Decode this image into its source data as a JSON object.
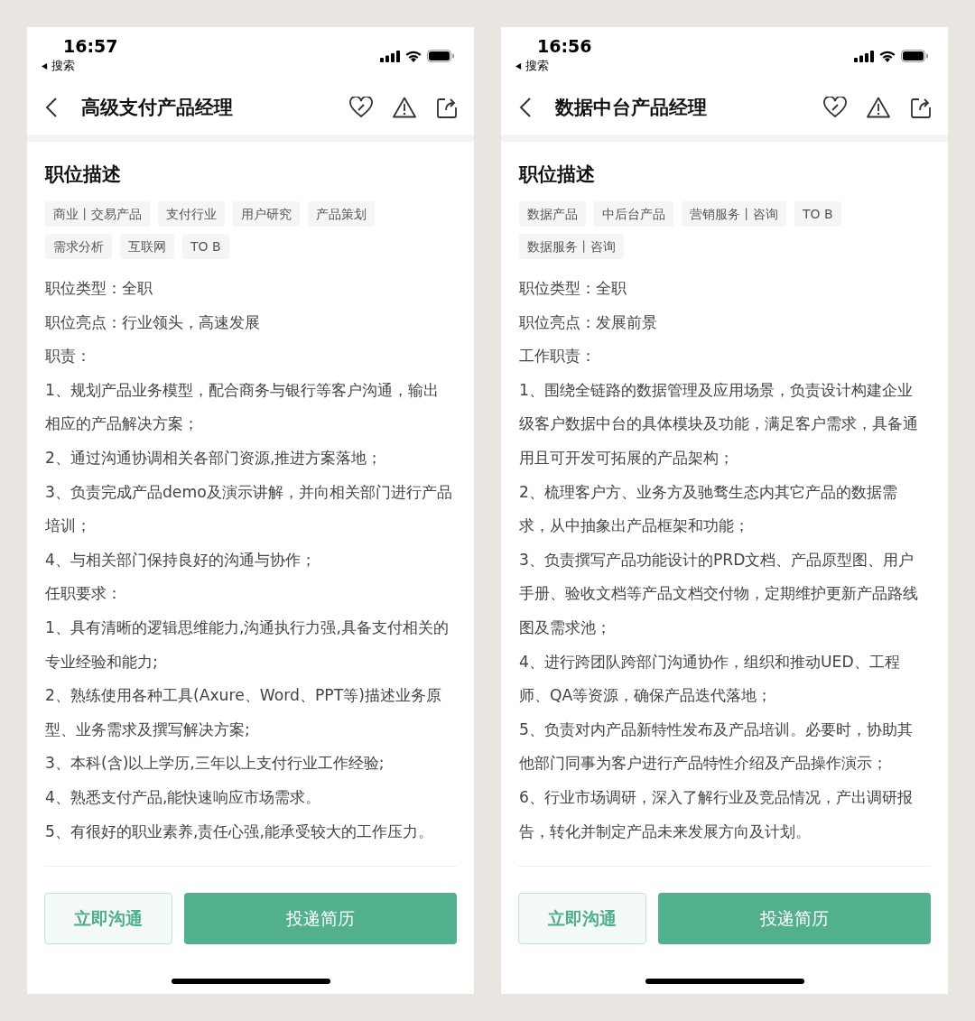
{
  "screens": [
    {
      "status_bar": {
        "time": "16:57",
        "back_app": "搜索"
      },
      "title": "高级支付产品经理",
      "section_title": "职位描述",
      "tags": [
        "商业丨交易产品",
        "支付行业",
        "用户研究",
        "产品策划",
        "需求分析",
        "互联网",
        "TO B"
      ],
      "lines": [
        "职位类型：全职",
        "职位亮点：行业领头，高速发展",
        "职责：",
        "1、规划产品业务模型，配合商务与银行等客户沟通，输出相应的产品解决方案；",
        "2、通过沟通协调相关各部门资源,推进方案落地；",
        "3、负责完成产品demo及演示讲解，并向相关部门进行产品培训；",
        "4、与相关部门保持良好的沟通与协作；",
        "任职要求：",
        "1、具有清晰的逻辑思维能力,沟通执行力强,具备支付相关的专业经验和能力;",
        "2、熟练使用各种工具(Axure、Word、PPT等)描述业务原型、业务需求及撰写解决方案;",
        "3、本科(含)以上学历,三年以上支付行业工作经验;",
        "4、熟悉支付产品,能快速响应市场需求。",
        "5、有很好的职业素养,责任心强,能承受较大的工作压力。"
      ],
      "buttons": {
        "chat": "立即沟通",
        "apply": "投递简历"
      }
    },
    {
      "status_bar": {
        "time": "16:56",
        "back_app": "搜索"
      },
      "title": "数据中台产品经理",
      "section_title": "职位描述",
      "tags": [
        "数据产品",
        "中后台产品",
        "营销服务丨咨询",
        "TO B",
        "数据服务丨咨询"
      ],
      "lines": [
        "职位类型：全职",
        "职位亮点：发展前景",
        "工作职责：",
        "1、围绕全链路的数据管理及应用场景，负责设计构建企业级客户数据中台的具体模块及功能，满足客户需求，具备通用且可开发可拓展的产品架构；",
        "2、梳理客户方、业务方及驰骛生态内其它产品的数据需求，从中抽象出产品框架和功能；",
        "3、负责撰写产品功能设计的PRD文档、产品原型图、用户手册、验收文档等产品文档交付物，定期维护更新产品路线图及需求池；",
        "4、进行跨团队跨部门沟通协作，组织和推动UED、工程师、QA等资源，确保产品迭代落地；",
        "5、负责对内产品新特性发布及产品培训。必要时，协助其他部门同事为客户进行产品特性介绍及产品操作演示；",
        "6、行业市场调研，深入了解行业及竞品情况，产出调研报告，转化并制定产品未来发展方向及计划。"
      ],
      "buttons": {
        "chat": "立即沟通",
        "apply": "投递简历"
      }
    }
  ]
}
